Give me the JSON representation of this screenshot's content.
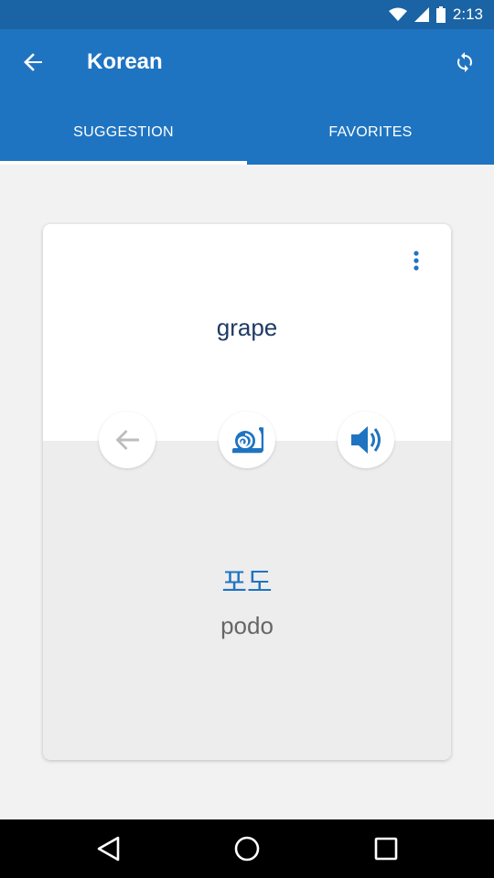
{
  "status_bar": {
    "time": "2:13",
    "icons": [
      "wifi-icon",
      "signal-icon",
      "battery-icon"
    ]
  },
  "app_bar": {
    "title": "Korean",
    "back_icon": "arrow-back-icon",
    "refresh_icon": "refresh-icon"
  },
  "tabs": [
    {
      "label": "SUGGESTION",
      "selected": true
    },
    {
      "label": "FAVORITES",
      "selected": false
    }
  ],
  "card": {
    "word": "grape",
    "korean": "포도",
    "romanization": "podo",
    "menu_icon": "more-vertical-icon",
    "actions": [
      {
        "icon": "arrow-left-icon"
      },
      {
        "icon": "snail-icon"
      },
      {
        "icon": "volume-icon"
      }
    ]
  },
  "nav_bar": {
    "icons": [
      "nav-back-icon",
      "nav-home-icon",
      "nav-recents-icon"
    ]
  },
  "colors": {
    "app_bar": "#1f74c1",
    "status_bar": "#1a63a4",
    "accent": "#1f74c1",
    "word_text": "#1e3b63",
    "background": "#f2f2f2"
  }
}
